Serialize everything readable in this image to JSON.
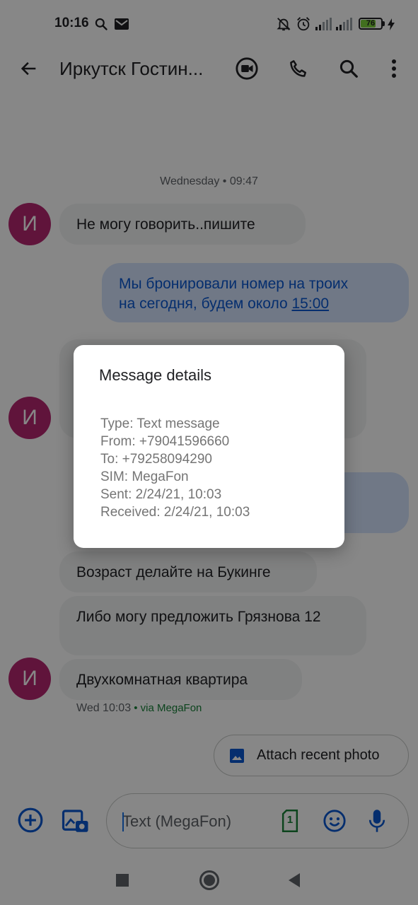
{
  "status_bar": {
    "time": "10:16",
    "battery": "76",
    "battery_level": 0.76
  },
  "app_bar": {
    "title": "Иркутск Гостин...",
    "back_icon": "arrow-back-icon",
    "actions": [
      "video-call-icon",
      "phone-icon",
      "search-icon",
      "more-vert-icon"
    ]
  },
  "conversation": {
    "date_separator": "Wednesday • 09:47",
    "avatar_letter": "И",
    "messages": [
      {
        "direction": "incoming",
        "text": "Не могу говорить..пишите"
      },
      {
        "direction": "outgoing",
        "text_line1": "Мы бронировали номер на троих",
        "text_line2_prefix": "на сегодня, будем около ",
        "link": "15:00"
      },
      {
        "direction": "incoming",
        "text": "Возраст делайте на Букинге"
      },
      {
        "direction": "incoming",
        "text": "Либо могу предложить Грязнова 12"
      },
      {
        "direction": "incoming",
        "text": "Двухкомнатная квартира"
      }
    ],
    "meta_time": "Wed 10:03",
    "meta_via": " • via MegaFon"
  },
  "attach_chip": {
    "label": "Attach recent photo",
    "icon": "image-icon"
  },
  "compose": {
    "placeholder": "Text (MegaFon)",
    "sim_slot": "1",
    "icons": [
      "add-circle-icon",
      "gallery-icon",
      "sim-icon",
      "emoji-icon",
      "mic-icon"
    ]
  },
  "dialog": {
    "title": "Message details",
    "lines": {
      "type": "Type: Text message",
      "from": "From: +79041596660",
      "to": "To: +79258094290",
      "sim": "SIM: MegaFon",
      "sent": "Sent: 2/24/21, 10:03",
      "received": "Received: 2/24/21, 10:03"
    }
  },
  "colors": {
    "accent": "#1a73e8",
    "avatar": "#b62670",
    "incoming_bubble": "#f1f3f4",
    "outgoing_bubble": "#d3e3fd",
    "outgoing_text": "#0b57d0",
    "via": "#188038"
  }
}
